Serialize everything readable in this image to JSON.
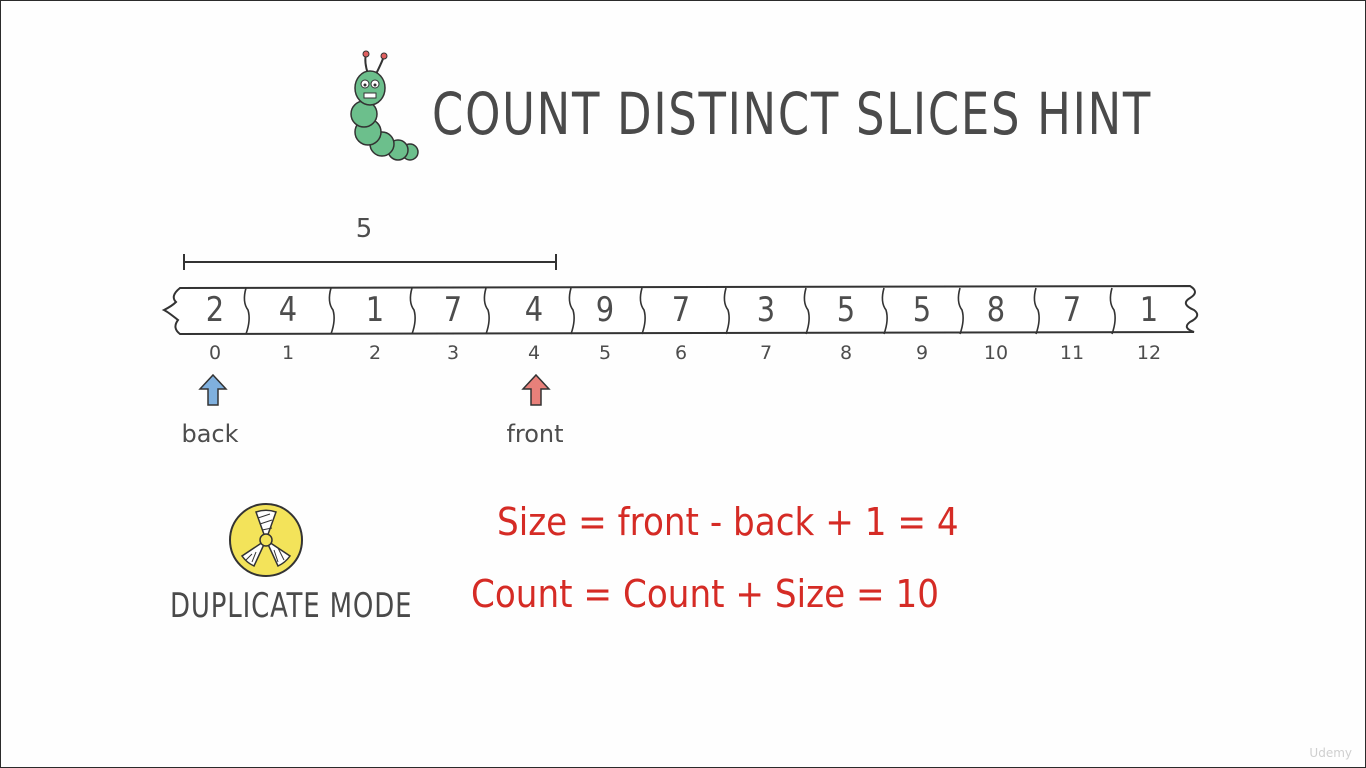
{
  "title": "COUNT DISTINCT SLICES HINT",
  "array": {
    "values": [
      "2",
      "4",
      "1",
      "7",
      "4",
      "9",
      "7",
      "3",
      "5",
      "5",
      "8",
      "7",
      "1"
    ],
    "indices": [
      "0",
      "1",
      "2",
      "3",
      "4",
      "5",
      "6",
      "7",
      "8",
      "9",
      "10",
      "11",
      "12"
    ]
  },
  "bracket": {
    "label": "5"
  },
  "pointers": {
    "back": {
      "label": "back",
      "index": 0,
      "color": "#7fb0de"
    },
    "front": {
      "label": "front",
      "index": 4,
      "color": "#e8807a"
    }
  },
  "equations": {
    "line1": "Size = front - back + 1   =  4",
    "line2": "Count = Count + Size         =  10"
  },
  "mode": {
    "label": "DUPLICATE MODE",
    "icon": "radiation-hazard-icon"
  },
  "colors": {
    "accent_red": "#d52b25",
    "text_gray": "#4a4a4a",
    "mascot_green": "#6cbf8c",
    "hazard_yellow": "#f3e35a"
  },
  "watermark": "Udemy"
}
